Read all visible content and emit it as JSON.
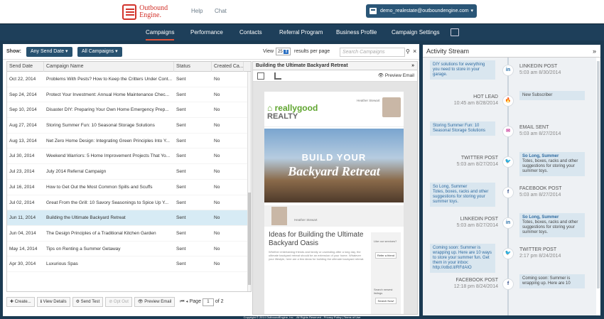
{
  "header": {
    "logo_text": "Outbound Engine.",
    "help": "Help",
    "chat": "Chat",
    "user": "demo_realestate@outboundengine.com"
  },
  "nav": {
    "items": [
      "Campaigns",
      "Performance",
      "Contacts",
      "Referral Program",
      "Business Profile",
      "Campaign Settings"
    ]
  },
  "toolbar": {
    "show_label": "Show:",
    "send_date_filter": "Any Send Date",
    "campaign_filter": "All Campaigns",
    "view_label": "View",
    "view_count": "25",
    "per_page": "results per page",
    "search_placeholder": "Search Campaigns"
  },
  "table": {
    "columns": [
      "Send Date",
      "Campaign Name",
      "Status",
      "Created Ca..."
    ],
    "rows": [
      [
        "Oct 22, 2014",
        "Problems With Pests? How to Keep the Critters Under Cont...",
        "Sent",
        "No"
      ],
      [
        "Sep 24, 2014",
        "Protect Your Investment: Annual Home Maintenance Chec...",
        "Sent",
        "No"
      ],
      [
        "Sep 10, 2014",
        "Disaster DIY: Preparing Your Own Home Emergency Prep...",
        "Sent",
        "No"
      ],
      [
        "Aug 27, 2014",
        "Storing Summer Fun: 10 Seasonal Storage Solutions",
        "Sent",
        "No"
      ],
      [
        "Aug 13, 2014",
        "Net Zero Home Design: Integrating Green Principles Into Y...",
        "Sent",
        "No"
      ],
      [
        "Jul 30, 2014",
        "Weekend Warriors: 5 Home Improvement Projects That Yo...",
        "Sent",
        "No"
      ],
      [
        "Jul 23, 2014",
        "July 2014 Referral Campaign",
        "Sent",
        "No"
      ],
      [
        "Jul 16, 2014",
        "How to Get Out the Most Common Spills and Scuffs",
        "Sent",
        "No"
      ],
      [
        "Jul 02, 2014",
        "Great From the Grill: 10 Savory Seasonings to Spice Up Y...",
        "Sent",
        "No"
      ],
      [
        "Jun 11, 2014",
        "Building the Ultimate Backyard Retreat",
        "Sent",
        "No"
      ],
      [
        "Jun 04, 2014",
        "The Design Principles of a Traditional Kitchen Garden",
        "Sent",
        "No"
      ],
      [
        "May 14, 2014",
        "Tips on Renting a Summer Getaway",
        "Sent",
        "No"
      ],
      [
        "Apr 30, 2014",
        "Luxurious Spas",
        "Sent",
        "No"
      ]
    ],
    "selected_index": 9
  },
  "footer": {
    "create": "Create...",
    "view_details": "View Details",
    "send_test": "Send Test",
    "opt_out": "Opt Out",
    "preview_email": "Preview Email",
    "page_label": "Page",
    "page_value": "1",
    "of_label": "of 2"
  },
  "preview": {
    "title": "Building the Ultimate Backyard Retreat",
    "preview_email": "Preview Email",
    "brand1": "reallygood",
    "brand2": "REALTY",
    "agent_name": "Heather Stewart",
    "hero_line1": "BUILD YOUR",
    "hero_line2": "Backyard Retreat",
    "article_title": "Ideas for Building the Ultimate Backyard Oasis",
    "article_body": "Whether entertaining friends and family or unwinding after a long day, the ultimate backyard retreat should be an extension of your home. Whatever your lifestyle, here are a few ideas for building the ultimate backyard retreat.",
    "side1": "Like our services?",
    "side2": "Refer a friend",
    "side3": "Search newest listings",
    "side4": "Search Now!"
  },
  "activity": {
    "title": "Activity Stream",
    "events": [
      {
        "side": "l",
        "bubble": "DIY solutions for everything you need to store in your garage.",
        "meta_type": "LINKEDIN POST",
        "meta_date": "5:03 am 8/30/2014",
        "icon": "in",
        "color": "#1f6aa5"
      },
      {
        "side": "r",
        "bubble": "New Subscriber",
        "meta_type": "HOT LEAD",
        "meta_date": "10:45 am 8/28/2014",
        "icon": "🔥",
        "color": "#d9391f"
      },
      {
        "side": "l",
        "bubble": "Storing Summer Fun: 10 Seasonal Storage Solutions",
        "meta_type": "EMAIL SENT",
        "meta_date": "5:03 am 8/27/2014",
        "icon": "✉",
        "color": "#c73a9a"
      },
      {
        "side": "r",
        "bubble_a": "So Long, Summer",
        "bubble": "Totes, boxes, racks and other suggestions for storing your summer toys.",
        "meta_type": "TWITTER POST",
        "meta_date": "5:03 am 8/27/2014",
        "icon": "🐦",
        "color": "#3aa0d8"
      },
      {
        "side": "l",
        "bubble_a": "So Long, Summer",
        "bubble": "Totes, boxes, racks and other suggestions for storing your summer toys.",
        "meta_type": "FACEBOOK POST",
        "meta_date": "5:03 am 8/27/2014",
        "icon": "f",
        "color": "#2e4a86"
      },
      {
        "side": "r",
        "bubble_a": "So Long, Summer",
        "bubble": "Totes, boxes, racks and other suggestions for storing your summer toys.",
        "meta_type": "LINKEDIN POST",
        "meta_date": "5:03 am 8/27/2014",
        "icon": "in",
        "color": "#1f6aa5"
      },
      {
        "side": "l",
        "bubble": "Coming soon: Summer is wrapping up. Here are 10 ways to store your summer fun. Get them in your inbox: http://otbd.it/RFdAIO",
        "meta_type": "TWITTER POST",
        "meta_date": "2:17 pm 8/24/2014",
        "icon": "🐦",
        "color": "#3aa0d8"
      },
      {
        "side": "r",
        "bubble": "Coming soon: Summer is wrapping up. Here are 10",
        "meta_type": "FACEBOOK POST",
        "meta_date": "12:18 pm 8/24/2014",
        "icon": "f",
        "color": "#2e4a86"
      }
    ]
  },
  "copyright": "Copyright © 2014 OutboundEngine, Inc. - All Rights Reserved - Privacy Policy | Terms of Use"
}
